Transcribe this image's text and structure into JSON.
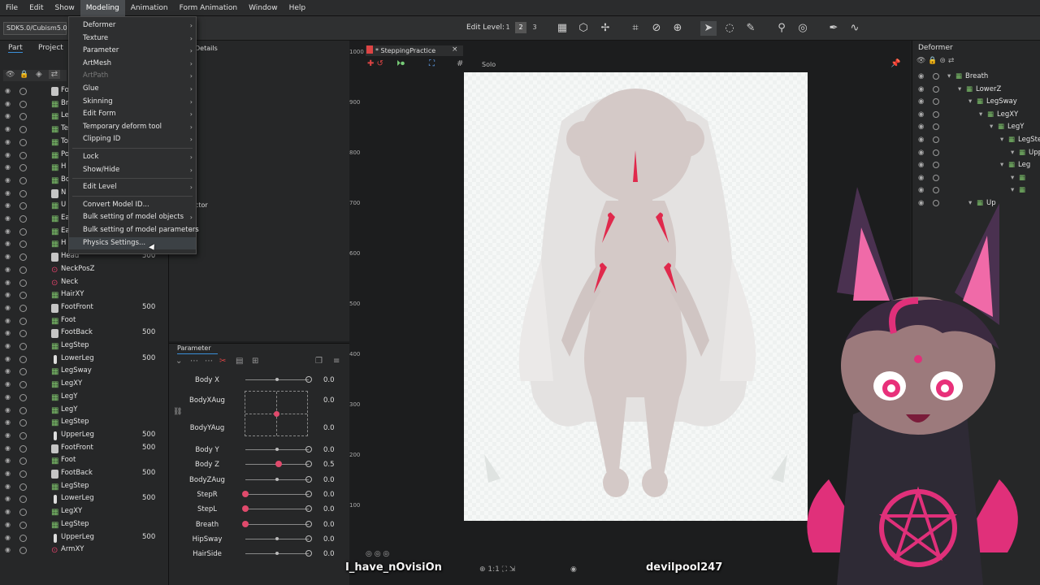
{
  "menubar": {
    "items": [
      "File",
      "Edit",
      "Show",
      "Modeling",
      "Animation",
      "Form Animation",
      "Window",
      "Help"
    ],
    "active": "Modeling"
  },
  "toolbar": {
    "sdk": "SDK5.0/Cubism5.0",
    "edit_level_label": "Edit Level:",
    "levels": [
      "1",
      "2",
      "3"
    ]
  },
  "left_tabs": {
    "part": "Part",
    "project": "Project"
  },
  "details_tab": "Details",
  "inspector_tab": "ctor",
  "menu": {
    "items": [
      {
        "label": "Deformer",
        "sub": true
      },
      {
        "label": "Texture",
        "sub": true
      },
      {
        "label": "Parameter",
        "sub": true
      },
      {
        "label": "ArtMesh",
        "sub": true
      },
      {
        "label": "ArtPath",
        "sub": true,
        "disabled": true
      },
      {
        "label": "Glue",
        "sub": true
      },
      {
        "label": "Skinning",
        "sub": true
      },
      {
        "label": "Edit Form",
        "sub": true
      },
      {
        "label": "Temporary deform tool",
        "sub": true
      },
      {
        "label": "Clipping ID",
        "sub": true
      },
      {
        "label": "Lock",
        "sub": true
      },
      {
        "label": "Show/Hide",
        "sub": true
      },
      {
        "label": "Edit Level",
        "sub": true
      },
      {
        "label": "Convert Model ID...",
        "sub": false
      },
      {
        "label": "Bulk setting of model objects",
        "sub": true
      },
      {
        "label": "Bulk setting of model parameters",
        "sub": true
      },
      {
        "label": "Physics Settings...",
        "sub": false,
        "highlighted": true
      }
    ]
  },
  "parts": [
    {
      "name": "Fold",
      "icon": "folder",
      "val": ""
    },
    {
      "name": "Br",
      "icon": "chk",
      "val": ""
    },
    {
      "name": "Le",
      "icon": "chk",
      "val": ""
    },
    {
      "name": "Te",
      "icon": "chk",
      "val": ""
    },
    {
      "name": "To",
      "icon": "chk",
      "val": ""
    },
    {
      "name": "Po",
      "icon": "chk",
      "val": ""
    },
    {
      "name": "H",
      "icon": "chk",
      "val": ""
    },
    {
      "name": "Bo",
      "icon": "chk",
      "val": ""
    },
    {
      "name": "N",
      "icon": "folder",
      "val": ""
    },
    {
      "name": "U",
      "icon": "chk",
      "val": ""
    },
    {
      "name": "Ea",
      "icon": "chk",
      "val": ""
    },
    {
      "name": "Ea",
      "icon": "chk",
      "val": ""
    },
    {
      "name": "H",
      "icon": "chk",
      "val": ""
    },
    {
      "name": "Head",
      "icon": "folder",
      "val": "500"
    },
    {
      "name": "NeckPosZ",
      "icon": "deform",
      "val": ""
    },
    {
      "name": "Neck",
      "icon": "deform",
      "val": ""
    },
    {
      "name": "HairXY",
      "icon": "chk",
      "val": ""
    },
    {
      "name": "FootFront",
      "icon": "folder",
      "val": "500"
    },
    {
      "name": "Foot",
      "icon": "chk",
      "val": ""
    },
    {
      "name": "FootBack",
      "icon": "folder",
      "val": "500"
    },
    {
      "name": "LegStep",
      "icon": "chk",
      "val": ""
    },
    {
      "name": "LowerLeg",
      "icon": "mesh",
      "val": "500"
    },
    {
      "name": "LegSway",
      "icon": "chk",
      "val": ""
    },
    {
      "name": "LegXY",
      "icon": "chk",
      "val": ""
    },
    {
      "name": "LegY",
      "icon": "chk",
      "val": ""
    },
    {
      "name": "LegY",
      "icon": "chk",
      "val": ""
    },
    {
      "name": "LegStep",
      "icon": "chk",
      "val": ""
    },
    {
      "name": "UpperLeg",
      "icon": "mesh",
      "val": "500"
    },
    {
      "name": "FootFront",
      "icon": "folder",
      "val": "500"
    },
    {
      "name": "Foot",
      "icon": "chk",
      "val": ""
    },
    {
      "name": "FootBack",
      "icon": "folder",
      "val": "500"
    },
    {
      "name": "LegStep",
      "icon": "chk",
      "val": ""
    },
    {
      "name": "LowerLeg",
      "icon": "mesh",
      "val": "500"
    },
    {
      "name": "LegXY",
      "icon": "chk",
      "val": ""
    },
    {
      "name": "LegStep",
      "icon": "chk",
      "val": ""
    },
    {
      "name": "UpperLeg",
      "icon": "mesh",
      "val": "500"
    },
    {
      "name": "ArmXY",
      "icon": "deform",
      "val": ""
    }
  ],
  "parameter_tab": "Parameter",
  "parameters": [
    {
      "name": "Body X",
      "val": "0.0",
      "level": 0.5,
      "grid": false
    },
    {
      "name": "BodyXAug",
      "val": "0.0",
      "level": 0.5,
      "grid": true
    },
    {
      "name": "BodyYAug",
      "val": "0.0",
      "level": 0.5,
      "grid": true
    },
    {
      "name": "Body Y",
      "val": "0.0",
      "level": 0.5
    },
    {
      "name": "Body Z",
      "val": "0.5",
      "level": 0.52
    },
    {
      "name": "BodyZAug",
      "val": "0.0",
      "level": 0.5
    },
    {
      "name": "StepR",
      "val": "0.0",
      "level": 0.0
    },
    {
      "name": "StepL",
      "val": "0.0",
      "level": 0.0
    },
    {
      "name": "Breath",
      "val": "0.0",
      "level": 0.0
    },
    {
      "name": "HipSway",
      "val": "0.0",
      "level": 0.5
    },
    {
      "name": "HairSide",
      "val": "0.0",
      "level": 0.5
    }
  ],
  "canvas": {
    "tab_title": "* SteppingPractice",
    "solo": "Solo",
    "ruler": [
      "1000",
      "900",
      "800",
      "700",
      "600",
      "500",
      "400",
      "300",
      "200",
      "100"
    ]
  },
  "right_panel": {
    "title": "Deformer",
    "items": [
      {
        "label": "Breath",
        "indent": 0
      },
      {
        "label": "LowerZ",
        "indent": 1
      },
      {
        "label": "LegSway",
        "indent": 2
      },
      {
        "label": "LegXY",
        "indent": 3
      },
      {
        "label": "LegY",
        "indent": 4
      },
      {
        "label": "LegStep",
        "indent": 5
      },
      {
        "label": "Upp",
        "indent": 6
      },
      {
        "label": "Leg",
        "indent": 5
      },
      {
        "label": "",
        "indent": 6
      },
      {
        "label": "",
        "indent": 6
      },
      {
        "label": "Up",
        "indent": 2
      }
    ]
  },
  "overlay": {
    "left_name": "I_have_nOvisiOn",
    "right_name": "devilpool247"
  }
}
